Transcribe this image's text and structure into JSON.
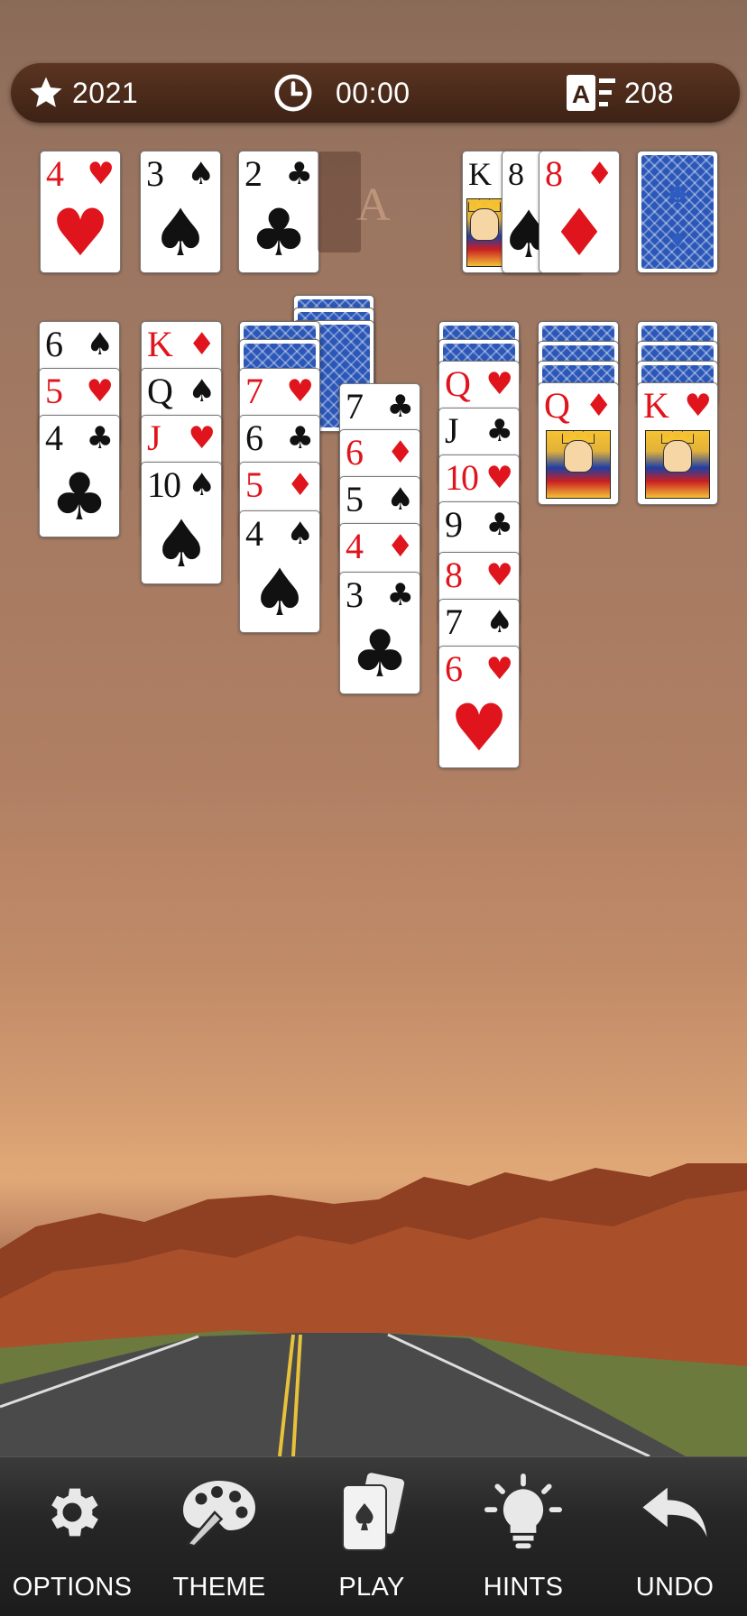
{
  "hud": {
    "best": "2021",
    "time": "00:00",
    "moves": "208"
  },
  "toolbar": {
    "options": "OPTIONS",
    "theme": "THEME",
    "play": "PLAY",
    "hints": "HINTS",
    "undo": "UNDO"
  },
  "placeholder_letter": "A",
  "foundation": [
    {
      "rank": "4",
      "suit": "♥",
      "color": "red"
    },
    {
      "rank": "3",
      "suit": "♠",
      "color": "black"
    },
    {
      "rank": "2",
      "suit": "♣",
      "color": "black"
    }
  ],
  "waste": [
    {
      "rank": "K",
      "suit": "♠",
      "color": "black",
      "face": true
    },
    {
      "rank": "8",
      "suit": "♠",
      "color": "black"
    },
    {
      "rank": "8",
      "suit": "♦",
      "color": "red"
    }
  ],
  "tableau": {
    "col1": [
      {
        "rank": "6",
        "suit": "♠",
        "color": "black"
      },
      {
        "rank": "5",
        "suit": "♥",
        "color": "red"
      },
      {
        "rank": "4",
        "suit": "♣",
        "color": "black"
      }
    ],
    "col2": [
      {
        "rank": "K",
        "suit": "♦",
        "color": "red"
      },
      {
        "rank": "Q",
        "suit": "♠",
        "color": "black"
      },
      {
        "rank": "J",
        "suit": "♥",
        "color": "red"
      },
      {
        "rank": "10",
        "suit": "♠",
        "color": "black"
      }
    ],
    "col3": [
      {
        "rank": "7",
        "suit": "♥",
        "color": "red"
      },
      {
        "rank": "6",
        "suit": "♣",
        "color": "black"
      },
      {
        "rank": "5",
        "suit": "♦",
        "color": "red"
      },
      {
        "rank": "4",
        "suit": "♠",
        "color": "black"
      }
    ],
    "col4": [
      {
        "rank": "7",
        "suit": "♣",
        "color": "black"
      },
      {
        "rank": "6",
        "suit": "♦",
        "color": "red"
      },
      {
        "rank": "5",
        "suit": "♠",
        "color": "black"
      },
      {
        "rank": "4",
        "suit": "♦",
        "color": "red"
      },
      {
        "rank": "3",
        "suit": "♣",
        "color": "black"
      }
    ],
    "col5": [
      {
        "rank": "Q",
        "suit": "♥",
        "color": "red"
      },
      {
        "rank": "J",
        "suit": "♣",
        "color": "black"
      },
      {
        "rank": "10",
        "suit": "♥",
        "color": "red"
      },
      {
        "rank": "9",
        "suit": "♣",
        "color": "black"
      },
      {
        "rank": "8",
        "suit": "♥",
        "color": "red"
      },
      {
        "rank": "7",
        "suit": "♠",
        "color": "black"
      },
      {
        "rank": "6",
        "suit": "♥",
        "color": "red"
      }
    ],
    "col6": [
      {
        "rank": "Q",
        "suit": "♦",
        "color": "red",
        "face": true
      }
    ],
    "col7": [
      {
        "rank": "K",
        "suit": "♥",
        "color": "red",
        "face": true
      }
    ]
  },
  "colors": {
    "card_red": "#e0141c",
    "card_black": "#111111",
    "card_back": "#2b57b8",
    "hud_bg": "#4a2a1b"
  }
}
